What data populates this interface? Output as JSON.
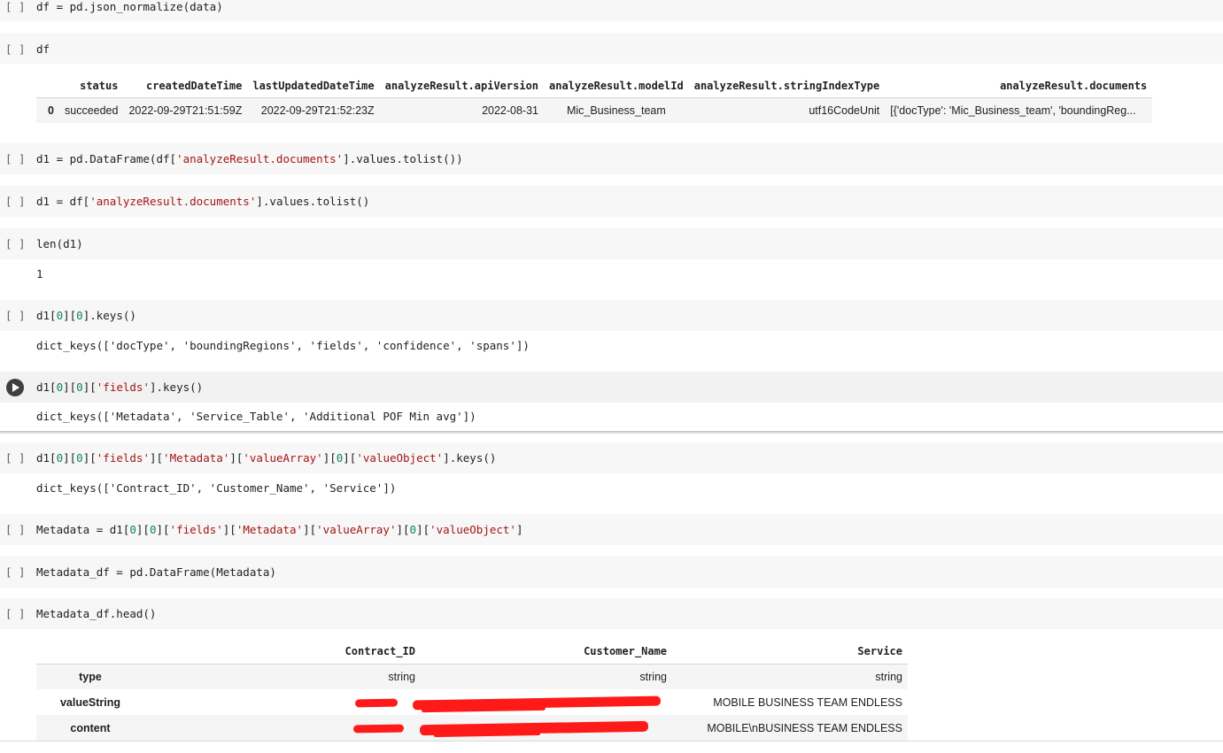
{
  "cells": [
    {
      "id": "c1",
      "bracket": "[ ]",
      "code": "df = pd.json_normalize(data)"
    },
    {
      "id": "c2",
      "bracket": "[ ]",
      "code": "df"
    },
    {
      "id": "c3",
      "bracket": "[ ]",
      "code_parts": [
        "d1 = pd.DataFrame(df[",
        "'analyzeResult.documents'",
        "].values.tolist())"
      ]
    },
    {
      "id": "c4",
      "bracket": "[ ]",
      "code_parts": [
        "d1 = df[",
        "'analyzeResult.documents'",
        "].values.tolist()"
      ]
    },
    {
      "id": "c5",
      "bracket": "[ ]",
      "code": "len(d1)",
      "output": "1"
    },
    {
      "id": "c6",
      "bracket": "[ ]",
      "code_parts": [
        "d1[",
        "0",
        "][",
        "0",
        "].keys()"
      ],
      "output": "dict_keys(['docType', 'boundingRegions', 'fields', 'confidence', 'spans'])"
    },
    {
      "id": "c7",
      "run_icon": "play-icon",
      "code_parts": [
        "d1[",
        "0",
        "][",
        "0",
        "][",
        "'fields'",
        "].keys()"
      ],
      "output": "dict_keys(['Metadata', 'Service_Table', 'Additional POF Min avg'])"
    },
    {
      "id": "c8",
      "bracket": "[ ]",
      "code_parts": [
        "d1[",
        "0",
        "][",
        "0",
        "][",
        "'fields'",
        "][",
        "'Metadata'",
        "][",
        "'valueArray'",
        "][",
        "0",
        "][",
        "'valueObject'",
        "].keys()"
      ],
      "output": "dict_keys(['Contract_ID', 'Customer_Name', 'Service'])"
    },
    {
      "id": "c9",
      "bracket": "[ ]",
      "code_parts": [
        "Metadata = d1[",
        "0",
        "][",
        "0",
        "][",
        "'fields'",
        "][",
        "'Metadata'",
        "][",
        "'valueArray'",
        "][",
        "0",
        "][",
        "'valueObject'",
        "]"
      ]
    },
    {
      "id": "c10",
      "bracket": "[ ]",
      "code": "Metadata_df = pd.DataFrame(Metadata)"
    },
    {
      "id": "c11",
      "bracket": "[ ]",
      "code": "Metadata_df.head()"
    }
  ],
  "df_table": {
    "columns": [
      "",
      "status",
      "createdDateTime",
      "lastUpdatedDateTime",
      "analyzeResult.apiVersion",
      "analyzeResult.modelId",
      "analyzeResult.stringIndexType",
      "analyzeResult.documents"
    ],
    "rows": [
      [
        "0",
        "succeeded",
        "2022-09-29T21:51:59Z",
        "2022-09-29T21:52:23Z",
        "2022-08-31",
        "Mic_Business_team",
        "utf16CodeUnit",
        "[{'docType': 'Mic_Business_team', 'boundingReg..."
      ]
    ]
  },
  "metadata_table": {
    "columns": [
      "",
      "Contract_ID",
      "Customer_Name",
      "Service"
    ],
    "rows": [
      [
        "type",
        "string",
        "string",
        "string"
      ],
      [
        "valueString",
        "",
        "",
        "MOBILE BUSINESS TEAM ENDLESS"
      ],
      [
        "content",
        "",
        "",
        "MOBILE\\nBUSINESS TEAM ENDLESS"
      ]
    ]
  },
  "colors": {
    "string": "#a31515",
    "number": "#098658",
    "redaction": "#ff1a1a"
  }
}
